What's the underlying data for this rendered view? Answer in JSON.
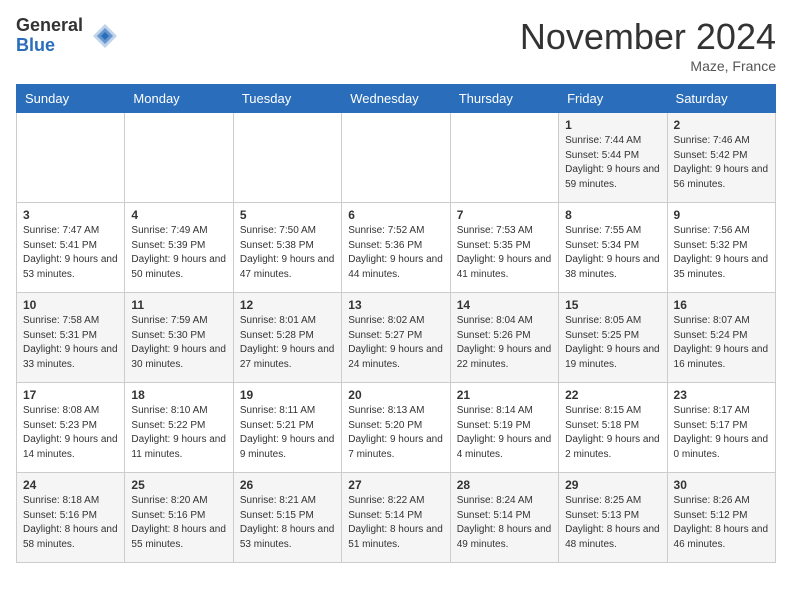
{
  "logo": {
    "general": "General",
    "blue": "Blue"
  },
  "title": "November 2024",
  "location": "Maze, France",
  "days_header": [
    "Sunday",
    "Monday",
    "Tuesday",
    "Wednesday",
    "Thursday",
    "Friday",
    "Saturday"
  ],
  "rows": [
    [
      {
        "day": "",
        "info": ""
      },
      {
        "day": "",
        "info": ""
      },
      {
        "day": "",
        "info": ""
      },
      {
        "day": "",
        "info": ""
      },
      {
        "day": "",
        "info": ""
      },
      {
        "day": "1",
        "info": "Sunrise: 7:44 AM\nSunset: 5:44 PM\nDaylight: 9 hours and 59 minutes."
      },
      {
        "day": "2",
        "info": "Sunrise: 7:46 AM\nSunset: 5:42 PM\nDaylight: 9 hours and 56 minutes."
      }
    ],
    [
      {
        "day": "3",
        "info": "Sunrise: 7:47 AM\nSunset: 5:41 PM\nDaylight: 9 hours and 53 minutes."
      },
      {
        "day": "4",
        "info": "Sunrise: 7:49 AM\nSunset: 5:39 PM\nDaylight: 9 hours and 50 minutes."
      },
      {
        "day": "5",
        "info": "Sunrise: 7:50 AM\nSunset: 5:38 PM\nDaylight: 9 hours and 47 minutes."
      },
      {
        "day": "6",
        "info": "Sunrise: 7:52 AM\nSunset: 5:36 PM\nDaylight: 9 hours and 44 minutes."
      },
      {
        "day": "7",
        "info": "Sunrise: 7:53 AM\nSunset: 5:35 PM\nDaylight: 9 hours and 41 minutes."
      },
      {
        "day": "8",
        "info": "Sunrise: 7:55 AM\nSunset: 5:34 PM\nDaylight: 9 hours and 38 minutes."
      },
      {
        "day": "9",
        "info": "Sunrise: 7:56 AM\nSunset: 5:32 PM\nDaylight: 9 hours and 35 minutes."
      }
    ],
    [
      {
        "day": "10",
        "info": "Sunrise: 7:58 AM\nSunset: 5:31 PM\nDaylight: 9 hours and 33 minutes."
      },
      {
        "day": "11",
        "info": "Sunrise: 7:59 AM\nSunset: 5:30 PM\nDaylight: 9 hours and 30 minutes."
      },
      {
        "day": "12",
        "info": "Sunrise: 8:01 AM\nSunset: 5:28 PM\nDaylight: 9 hours and 27 minutes."
      },
      {
        "day": "13",
        "info": "Sunrise: 8:02 AM\nSunset: 5:27 PM\nDaylight: 9 hours and 24 minutes."
      },
      {
        "day": "14",
        "info": "Sunrise: 8:04 AM\nSunset: 5:26 PM\nDaylight: 9 hours and 22 minutes."
      },
      {
        "day": "15",
        "info": "Sunrise: 8:05 AM\nSunset: 5:25 PM\nDaylight: 9 hours and 19 minutes."
      },
      {
        "day": "16",
        "info": "Sunrise: 8:07 AM\nSunset: 5:24 PM\nDaylight: 9 hours and 16 minutes."
      }
    ],
    [
      {
        "day": "17",
        "info": "Sunrise: 8:08 AM\nSunset: 5:23 PM\nDaylight: 9 hours and 14 minutes."
      },
      {
        "day": "18",
        "info": "Sunrise: 8:10 AM\nSunset: 5:22 PM\nDaylight: 9 hours and 11 minutes."
      },
      {
        "day": "19",
        "info": "Sunrise: 8:11 AM\nSunset: 5:21 PM\nDaylight: 9 hours and 9 minutes."
      },
      {
        "day": "20",
        "info": "Sunrise: 8:13 AM\nSunset: 5:20 PM\nDaylight: 9 hours and 7 minutes."
      },
      {
        "day": "21",
        "info": "Sunrise: 8:14 AM\nSunset: 5:19 PM\nDaylight: 9 hours and 4 minutes."
      },
      {
        "day": "22",
        "info": "Sunrise: 8:15 AM\nSunset: 5:18 PM\nDaylight: 9 hours and 2 minutes."
      },
      {
        "day": "23",
        "info": "Sunrise: 8:17 AM\nSunset: 5:17 PM\nDaylight: 9 hours and 0 minutes."
      }
    ],
    [
      {
        "day": "24",
        "info": "Sunrise: 8:18 AM\nSunset: 5:16 PM\nDaylight: 8 hours and 58 minutes."
      },
      {
        "day": "25",
        "info": "Sunrise: 8:20 AM\nSunset: 5:16 PM\nDaylight: 8 hours and 55 minutes."
      },
      {
        "day": "26",
        "info": "Sunrise: 8:21 AM\nSunset: 5:15 PM\nDaylight: 8 hours and 53 minutes."
      },
      {
        "day": "27",
        "info": "Sunrise: 8:22 AM\nSunset: 5:14 PM\nDaylight: 8 hours and 51 minutes."
      },
      {
        "day": "28",
        "info": "Sunrise: 8:24 AM\nSunset: 5:14 PM\nDaylight: 8 hours and 49 minutes."
      },
      {
        "day": "29",
        "info": "Sunrise: 8:25 AM\nSunset: 5:13 PM\nDaylight: 8 hours and 48 minutes."
      },
      {
        "day": "30",
        "info": "Sunrise: 8:26 AM\nSunset: 5:12 PM\nDaylight: 8 hours and 46 minutes."
      }
    ]
  ]
}
